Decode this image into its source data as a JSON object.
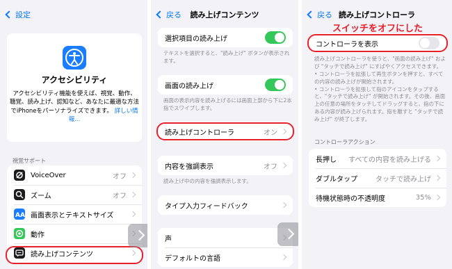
{
  "panel1": {
    "back_label": "設定",
    "hero": {
      "title": "アクセシビリティ",
      "desc": "アクセシビリティ機能を使えば、視覚、動作、聴覚、読み上げ、認知など、あなたに最適な方法でiPhoneをパーソナライズできます。",
      "link": "詳しい情報..."
    },
    "section_header": "視覚サポート",
    "items": [
      {
        "label": "VoiceOver",
        "value": "オフ",
        "icon": "voiceover-icon",
        "color": "#1c1c1e"
      },
      {
        "label": "ズーム",
        "value": "オフ",
        "icon": "zoom-icon",
        "color": "#1c1c1e"
      },
      {
        "label": "画面表示とテキストサイズ",
        "value": "",
        "icon": "text-size-icon",
        "color": "#1a7dff"
      },
      {
        "label": "動作",
        "value": "",
        "icon": "motion-icon",
        "color": "#34c759"
      },
      {
        "label": "読み上げコンテンツ",
        "value": "",
        "icon": "spoken-content-icon",
        "color": "#1c1c1e"
      }
    ]
  },
  "panel2": {
    "back_label": "戻る",
    "title": "読み上げコンテンツ",
    "speak_selection": "選択項目の読み上げ",
    "speak_selection_note": "テキストを選択すると、\"読み上げ\" ボタンが表示されます。",
    "speak_screen": "画面の読み上げ",
    "speak_screen_note": "画面の表示内容を読み上げるには画面上部から下に2本指でスワイプします。",
    "controller": "読み上げコントローラ",
    "controller_value": "オン",
    "highlight": "内容を強調表示",
    "highlight_value": "オフ",
    "highlight_note": "読み上げ中の内容を強調表示します。",
    "typing_feedback": "タイプ入力フィードバック",
    "voices": "声",
    "default_language": "デフォルトの言語"
  },
  "panel3": {
    "back_label": "戻る",
    "title": "読み上げコントローラ",
    "annotation": "スイッチをオフにした",
    "show_controller": "コントローラを表示",
    "note": "読み上げコントローラを使うと、\"画面の読み上げ\" および \"タッチで読み上げ\" にすばやくアクセスできます。\n• コントローラを拡張して再生ボタンを押すと、すべての内容の読み上げが開始されます。\n• コントローラを拡張して指のアイコンをタップすると、\"タッチで読み上げ\" が開始されます。その後、画面上の任意の場所をタッチしてドラッグすると、指の下にある内容が読み上げられます。指を離すと \"タッチで読み上げ\" が終了します。",
    "section_header": "コントローラアクション",
    "long_press": "長押し",
    "long_press_value": "すべての内容を読み上げる",
    "double_tap": "ダブルタップ",
    "double_tap_value": "タッチで読み上げ",
    "idle_opacity": "待機状態時の不透明度",
    "idle_opacity_value": "35%"
  },
  "colors": {
    "accent": "#0a7aff",
    "toggle_on": "#34c759",
    "annotation_red": "#e8202c"
  }
}
